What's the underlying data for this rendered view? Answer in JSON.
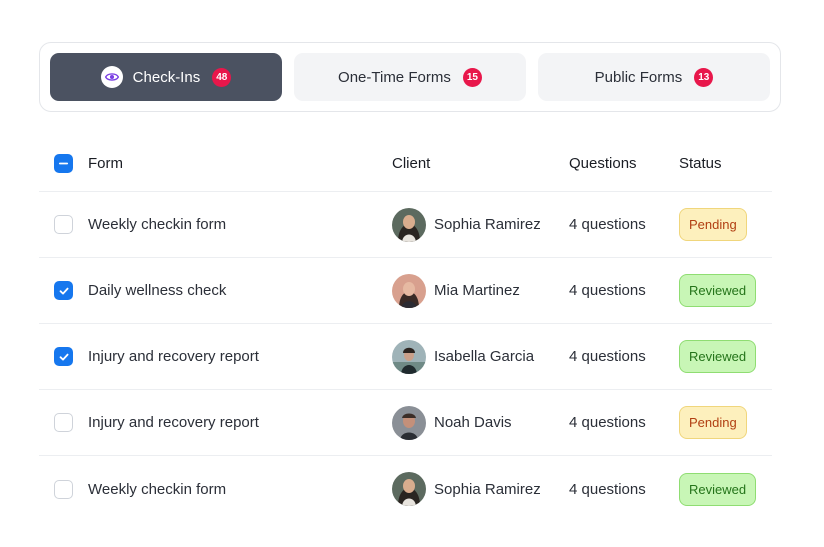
{
  "tabs": [
    {
      "label": "Check-Ins",
      "count": "48",
      "active": true,
      "icon": "eye-icon"
    },
    {
      "label": "One-Time Forms",
      "count": "15",
      "active": false
    },
    {
      "label": "Public Forms",
      "count": "13",
      "active": false
    }
  ],
  "table": {
    "headers": {
      "form": "Form",
      "client": "Client",
      "questions": "Questions",
      "status": "Status"
    },
    "rows": [
      {
        "form": "Weekly checkin form",
        "client": "Sophia Ramirez",
        "questions": "4 questions",
        "status": "Pending",
        "checked": false
      },
      {
        "form": "Daily wellness check",
        "client": "Mia Martinez",
        "questions": "4 questions",
        "status": "Reviewed",
        "checked": true
      },
      {
        "form": "Injury and recovery report",
        "client": "Isabella Garcia",
        "questions": "4 questions",
        "status": "Reviewed",
        "checked": true
      },
      {
        "form": "Injury and recovery report",
        "client": "Noah Davis",
        "questions": "4 questions",
        "status": "Pending",
        "checked": false
      },
      {
        "form": "Weekly checkin form",
        "client": "Sophia Ramirez",
        "questions": "4 questions",
        "status": "Reviewed",
        "checked": false
      }
    ]
  },
  "colors": {
    "accent": "#1677ee",
    "tab_active": "#4b5261",
    "badge": "#e8174b",
    "pending_bg": "#fdf0bd",
    "pending_text": "#b13f12",
    "reviewed_bg": "#c8f6b6",
    "reviewed_text": "#24741a"
  }
}
